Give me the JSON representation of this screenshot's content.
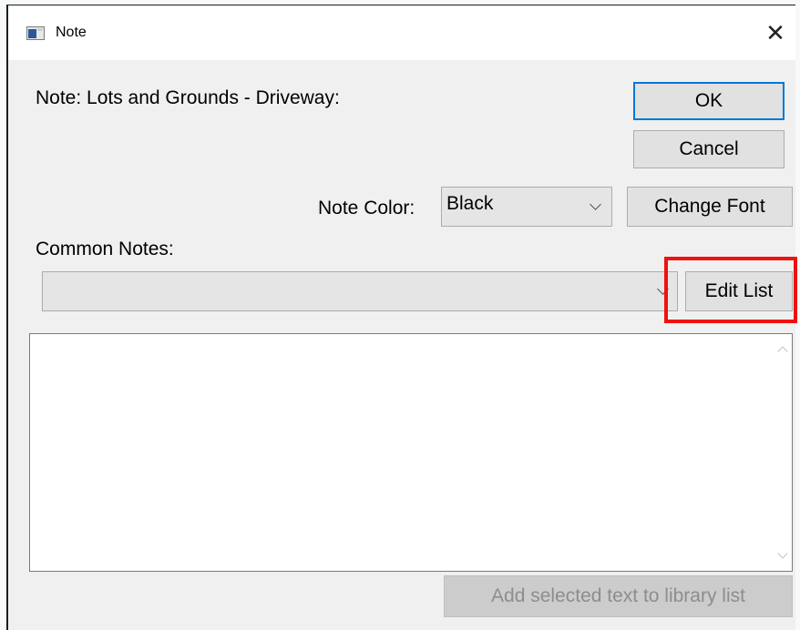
{
  "window": {
    "title": "Note",
    "close_glyph": "✕"
  },
  "note_label": "Note: Lots and Grounds - Driveway:",
  "buttons": {
    "ok": "OK",
    "cancel": "Cancel",
    "change_font": "Change Font",
    "edit_list": "Edit List",
    "add_to_library": "Add selected text to library list"
  },
  "note_color": {
    "label": "Note Color:",
    "selected": "Black"
  },
  "common_notes": {
    "label": "Common Notes:",
    "selected": ""
  },
  "note_text": "",
  "colors": {
    "accent_focus": "#0078d7",
    "highlight_box": "#ee1111",
    "dialog_bg": "#f0f0f0"
  }
}
